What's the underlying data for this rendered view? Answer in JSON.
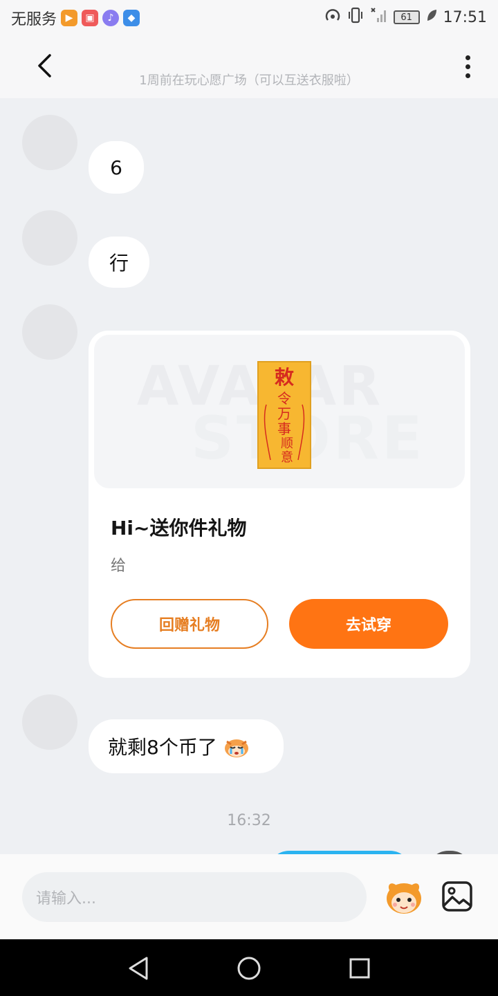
{
  "status_bar": {
    "carrier": "无服务",
    "battery": "61",
    "time": "17:51"
  },
  "header": {
    "subtitle": "1周前在玩心愿广场（可以互送衣服啦）"
  },
  "messages": [
    {
      "text": "6"
    },
    {
      "text": "行"
    },
    {
      "text": "就剩8个币了"
    }
  ],
  "gift_card": {
    "watermark_line1": "AVATAR",
    "watermark_line2": "STORE",
    "charm_text": "敕令万事顺意",
    "title": "Hi~送你件礼物",
    "subtitle": "给",
    "return_gift_label": "回赠礼物",
    "try_on_label": "去试穿"
  },
  "timestamp": "16:32",
  "input": {
    "placeholder": "请输入..."
  },
  "colors": {
    "accent": "#ff7413",
    "own_bubble": "#2bb3f0",
    "background": "#eef0f3"
  }
}
